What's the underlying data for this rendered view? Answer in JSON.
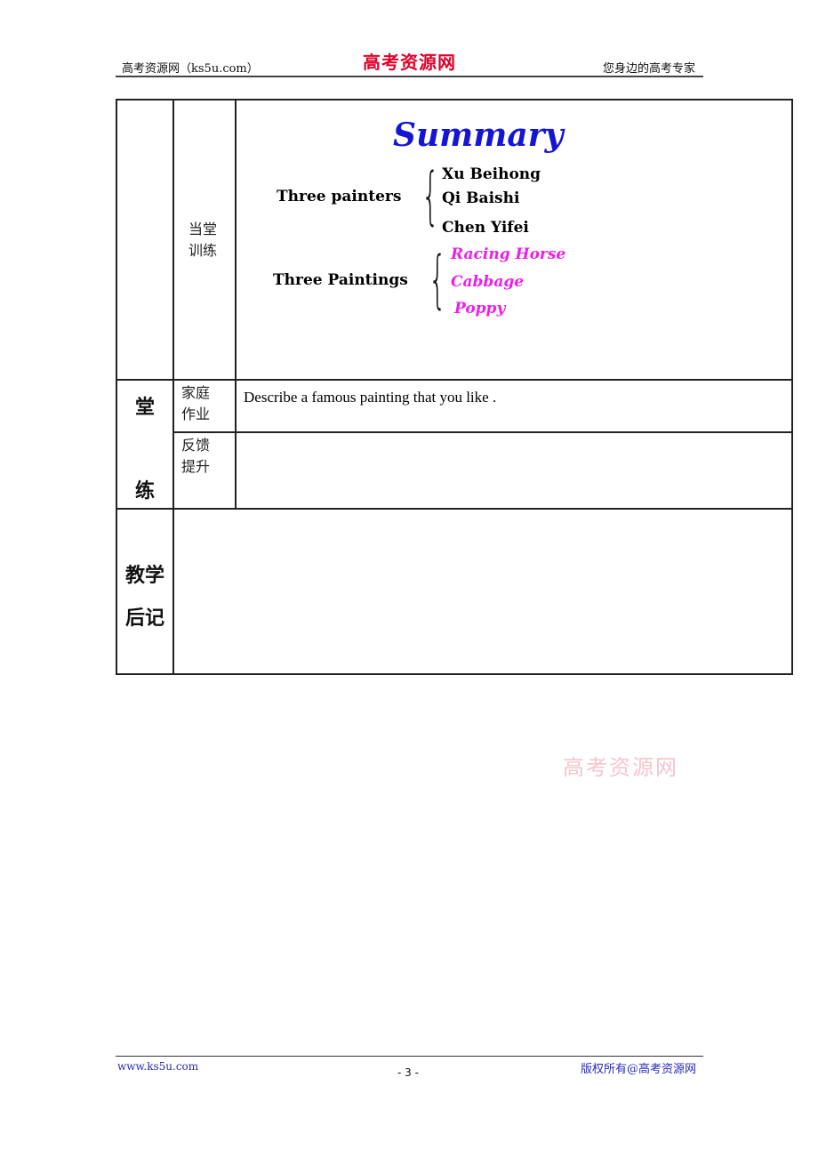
{
  "header": {
    "left": "高考资源网（ks5u.com）",
    "logo": "高考资源网",
    "right": "您身边的高考专家"
  },
  "table": {
    "practice": {
      "label_line1": "当堂",
      "label_line2": "训练",
      "summary": {
        "title": "Summary",
        "groups": [
          {
            "label": "Three painters",
            "items": [
              "Xu Beihong",
              "Qi Baishi",
              "Chen Yifei"
            ]
          },
          {
            "label": "Three Paintings",
            "items": [
              "Racing Horse",
              "Cabbage",
              "Poppy"
            ]
          }
        ]
      }
    },
    "section_label_top": "堂",
    "section_label_bottom": "练",
    "homework": {
      "label_line1": "家庭",
      "label_line2": "作业",
      "text": "Describe a famous painting that you like ."
    },
    "feedback": {
      "label_line1": "反馈",
      "label_line2": "提升",
      "text": ""
    },
    "reflection": {
      "label_line1": "教学",
      "label_line2": "后记",
      "text": ""
    }
  },
  "watermark": "高考资源网",
  "footer": {
    "left": "www.ks5u.com",
    "page": "- 3 -",
    "right": "版权所有@高考资源网"
  },
  "colors": {
    "summary_title": "#1515d6",
    "paintings": "#ee1ee8",
    "logo": "#e0002a",
    "footer_link": "#2a2ab8"
  }
}
